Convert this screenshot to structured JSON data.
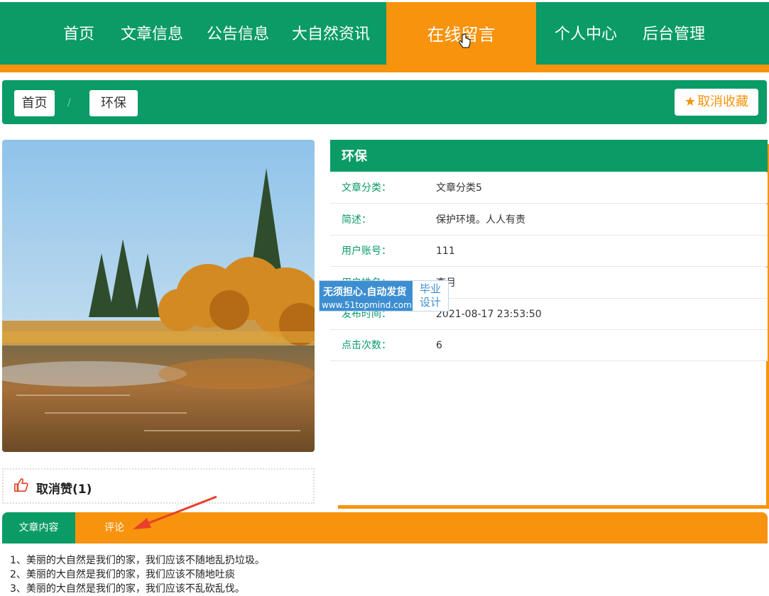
{
  "nav": {
    "items": [
      "首页",
      "文章信息",
      "公告信息",
      "大自然资讯",
      "在线留言",
      "个人中心",
      "后台管理"
    ],
    "active": "在线留言"
  },
  "breadcrumb": {
    "home": "首页",
    "separator": "/",
    "current": "环保"
  },
  "favorite_button": "取消收藏",
  "like": {
    "label": "取消赞(1)"
  },
  "article": {
    "title": "环保",
    "fields": [
      {
        "key": "文章分类：",
        "value": "文章分类5"
      },
      {
        "key": "简述：",
        "value": "保护环境。人人有责"
      },
      {
        "key": "用户账号：",
        "value": "111"
      },
      {
        "key": "用户姓名：",
        "value": "李月"
      },
      {
        "key": "发布时间：",
        "value": "2021-08-17 23:53:50"
      },
      {
        "key": "点击次数：",
        "value": "6"
      }
    ]
  },
  "watermark": {
    "line1": "无须担心.自动发货",
    "line2": "www.51topmind.com",
    "badge1": "毕业",
    "badge2": "设计"
  },
  "tabs": [
    "文章内容",
    "评论"
  ],
  "content_lines": [
    "1、美丽的大自然是我们的家，我们应该不随地乱扔垃圾。",
    "2、美丽的大自然是我们的家，我们应该不随地吐痰",
    "3、美丽的大自然是我们的家，我们应该不乱砍乱伐。"
  ],
  "colors": {
    "primary": "#0a9b66",
    "accent": "#f7930c"
  }
}
